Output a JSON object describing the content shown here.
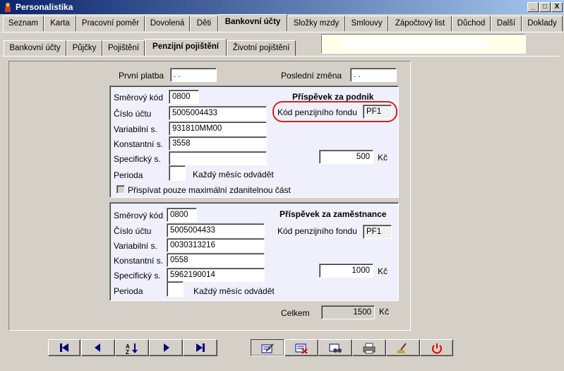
{
  "window": {
    "title": "Personalistika",
    "controls": [
      "_",
      "□",
      "X"
    ]
  },
  "main_tabs": [
    "Seznam",
    "Karta",
    "Pracovní poměr",
    "Dovolená",
    "Děti",
    "Bankovní účty",
    "Složky mzdy",
    "Smlouvy",
    "Zápočtový list",
    "Důchod",
    "Další",
    "Doklady"
  ],
  "main_tabs_active": "Bankovní účty",
  "sub_tabs": [
    "Bankovní účty",
    "Půjčky",
    "Pojištění",
    "Penzijní pojištění",
    "Životní pojištění"
  ],
  "sub_tabs_active": "Penzijní pojištění",
  "top": {
    "first_payment_label": "První platba",
    "first_payment_value": " . .",
    "last_change_label": "Poslední změna",
    "last_change_value": " . ."
  },
  "employer": {
    "heading": "Příspěvek za podnik",
    "bank_code_label": "Směrový kód",
    "bank_code": "0800",
    "account_label": "Číslo účtu",
    "account": "5005004433",
    "variable_label": "Variabilní s.",
    "variable": "931810MM00",
    "constant_label": "Konstantní s.",
    "constant": "3558",
    "specific_label": "Specifický s.",
    "specific": "",
    "fund_code_label": "Kód penzijního fondu",
    "fund_code": "PF1",
    "amount": "500",
    "currency": "Kč",
    "period_label": "Perioda",
    "period": "",
    "period_desc": "Každý měsíc odvádět",
    "max_checkbox_label": "Přispívat pouze maximální zdanitelnou část",
    "highlight_color": "#d42020"
  },
  "employee": {
    "heading": "Příspěvek za zaměstnance",
    "bank_code_label": "Směrový kód",
    "bank_code": "0800",
    "account_label": "Číslo účtu",
    "account": "5005004433",
    "variable_label": "Variabilní s.",
    "variable": "0030313216",
    "constant_label": "Konstantní s.",
    "constant": "0558",
    "specific_label": "Specifický s.",
    "specific": "5962190014",
    "fund_code_label": "Kód penzijního fondu",
    "fund_code": "PF1",
    "amount": "1000",
    "currency": "Kč",
    "period_label": "Perioda",
    "period": "",
    "period_desc": "Každý měsíc odvádět"
  },
  "total": {
    "label": "Celkem",
    "value": "1500",
    "currency": "Kč"
  },
  "toolbar": {
    "nav": [
      "first-record-icon",
      "previous-record-icon",
      "sort-az-icon",
      "next-record-icon",
      "last-record-icon"
    ],
    "actions": [
      "edit-record-icon",
      "delete-record-icon",
      "find-record-icon",
      "print-icon",
      "clear-icon",
      "power-icon"
    ]
  }
}
